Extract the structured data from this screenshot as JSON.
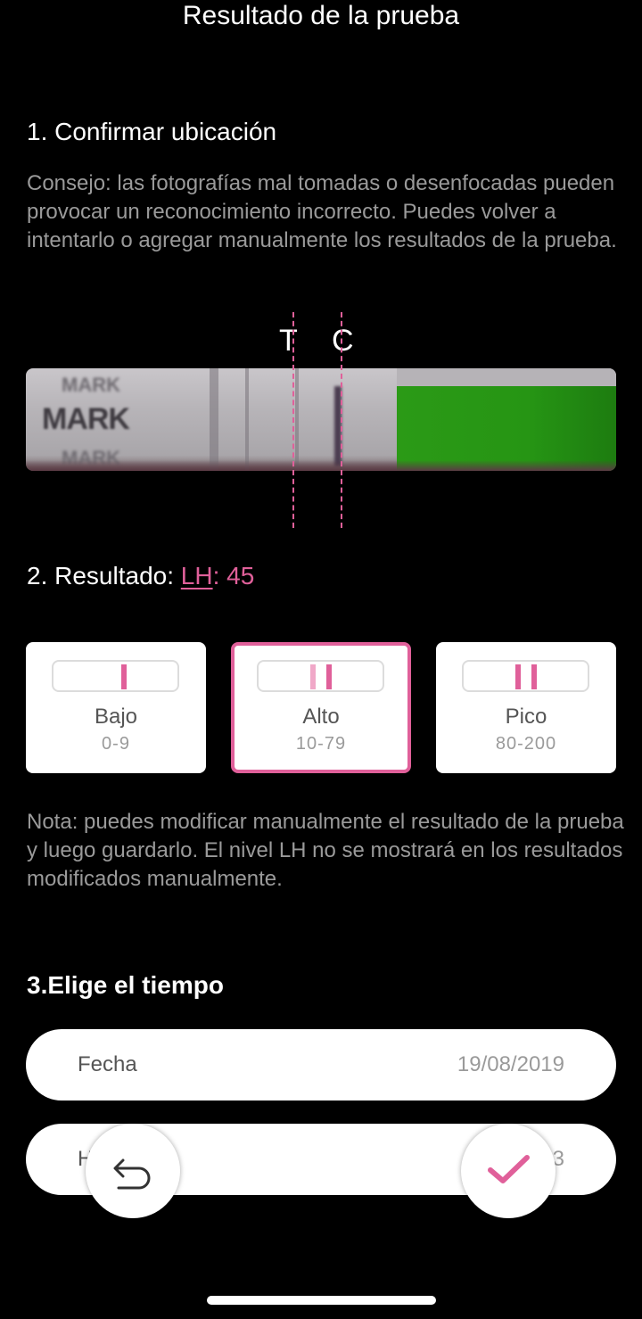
{
  "header": {
    "title": "Resultado de la prueba"
  },
  "step1": {
    "title": "1. Confirmar ubicación",
    "tip": "Consejo: las fotografías mal tomadas o desenfocadas pueden provocar un reconocimiento incorrecto. Puedes volver a intentarlo o agregar manualmente los resultados de la prueba.",
    "marker_t": "T",
    "marker_c": "C",
    "strip_text": "MARK"
  },
  "step2": {
    "label": "2. Resultado: ",
    "lh_label": "LH",
    "lh_sep": ": ",
    "lh_value": "45",
    "options": [
      {
        "name": "Bajo",
        "range": "0-9",
        "selected": false
      },
      {
        "name": "Alto",
        "range": "10-79",
        "selected": true
      },
      {
        "name": "Pico",
        "range": "80-200",
        "selected": false
      }
    ],
    "note": "Nota: puedes modificar manualmente el resultado de la prueba y luego guardarlo. El nivel LH no se mostrará en los resultados modificados manualmente."
  },
  "step3": {
    "title": "3.Elige el tiempo",
    "date_label": "Fecha",
    "date_value": "19/08/2019",
    "time_label": "H",
    "time_value": "3"
  },
  "actions": {
    "undo_icon": "undo-icon",
    "confirm_icon": "check-icon"
  },
  "colors": {
    "accent": "#e0609a",
    "background": "#000000",
    "muted_text": "#9a9a9a"
  }
}
